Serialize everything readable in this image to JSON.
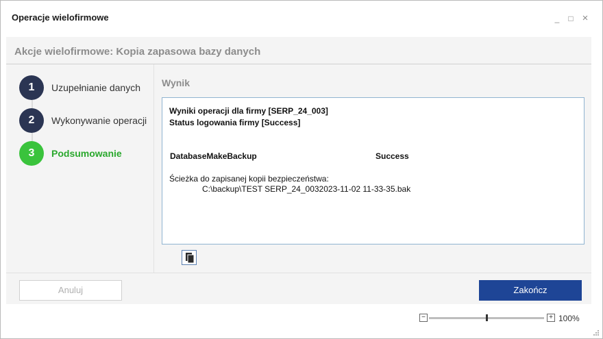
{
  "window": {
    "title": "Operacje wielofirmowe",
    "controls": {
      "minimize": "_",
      "maximize": "□",
      "close": "×"
    }
  },
  "panel": {
    "title": "Akcje wielofirmowe: Kopia zapasowa bazy danych"
  },
  "steps": [
    {
      "number": "1",
      "label": "Uzupełnianie danych",
      "state": "done"
    },
    {
      "number": "2",
      "label": "Wykonywanie operacji",
      "state": "done"
    },
    {
      "number": "3",
      "label": "Podsumowanie",
      "state": "active"
    }
  ],
  "result": {
    "section_label": "Wynik",
    "line1": "Wyniki operacji dla firmy [SERP_24_003]",
    "line2": "Status logowania firmy [Success]",
    "operation_name": "DatabaseMakeBackup",
    "operation_status": "Success",
    "path_label": "Ścieżka do zapisanej kopii bezpieczeństwa:",
    "path_value": "C:\\backup\\TEST SERP_24_0032023-11-02 11-33-35.bak"
  },
  "buttons": {
    "cancel": "Anuluj",
    "finish": "Zakończ"
  },
  "zoom": {
    "minus": "−",
    "plus": "+",
    "value": "100%",
    "level": 0.5
  },
  "colors": {
    "step_dark": "#2b3553",
    "step_active": "#3ac33c",
    "active_label": "#2aa82d",
    "finish_button": "#1e4596"
  },
  "icons": {
    "copy": "copy-icon",
    "resize": "resize-grip-icon"
  }
}
